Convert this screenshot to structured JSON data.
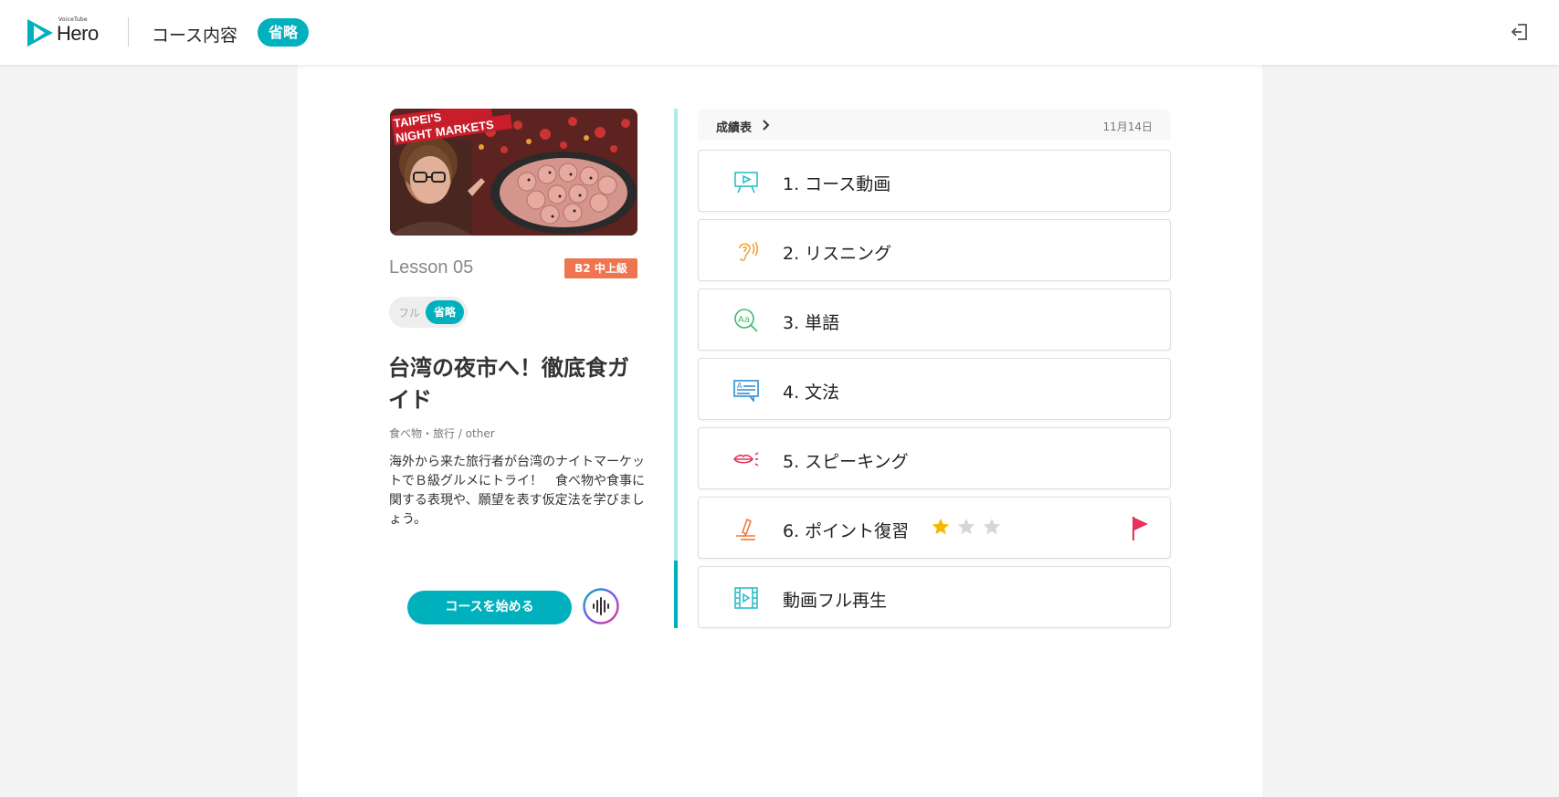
{
  "header": {
    "logo_small": "VoiceTube",
    "logo_text": "Hero",
    "title": "コース内容",
    "badge": "省略"
  },
  "lesson": {
    "thumbnail_caption": "TAIPEI'S NIGHT MARKETS",
    "label": "Lesson 05",
    "level": "B2 中上級",
    "toggle": {
      "full": "フル",
      "short": "省略"
    },
    "title": "台湾の夜市へ！徹底食ガイド",
    "category": "食べ物・旅行 / other",
    "description": "海外から来た旅行者が台湾のナイトマーケットでＢ級グルメにトライ！　食べ物や食事に関する表現や、願望を表す仮定法を学びましょう。",
    "start_button": "コースを始める"
  },
  "scoreboard": {
    "link": "成績表",
    "date": "11月14日"
  },
  "sections": [
    {
      "label": "1. コース動画",
      "icon": "presentation-icon"
    },
    {
      "label": "2. リスニング",
      "icon": "ear-icon"
    },
    {
      "label": "3. 単語",
      "icon": "vocabulary-search-icon"
    },
    {
      "label": "4. 文法",
      "icon": "grammar-chat-icon"
    },
    {
      "label": "5. スピーキング",
      "icon": "lips-icon"
    },
    {
      "label": "6. ポイント復習",
      "icon": "pencil-icon",
      "stars_filled": 1,
      "stars_total": 3
    },
    {
      "label": "動画フル再生",
      "icon": "film-icon"
    }
  ],
  "colors": {
    "accent": "#00b1bd",
    "level_badge": "#ef7550",
    "star": "#f5b800",
    "flag": "#e8315b"
  },
  "progress": 0.13
}
